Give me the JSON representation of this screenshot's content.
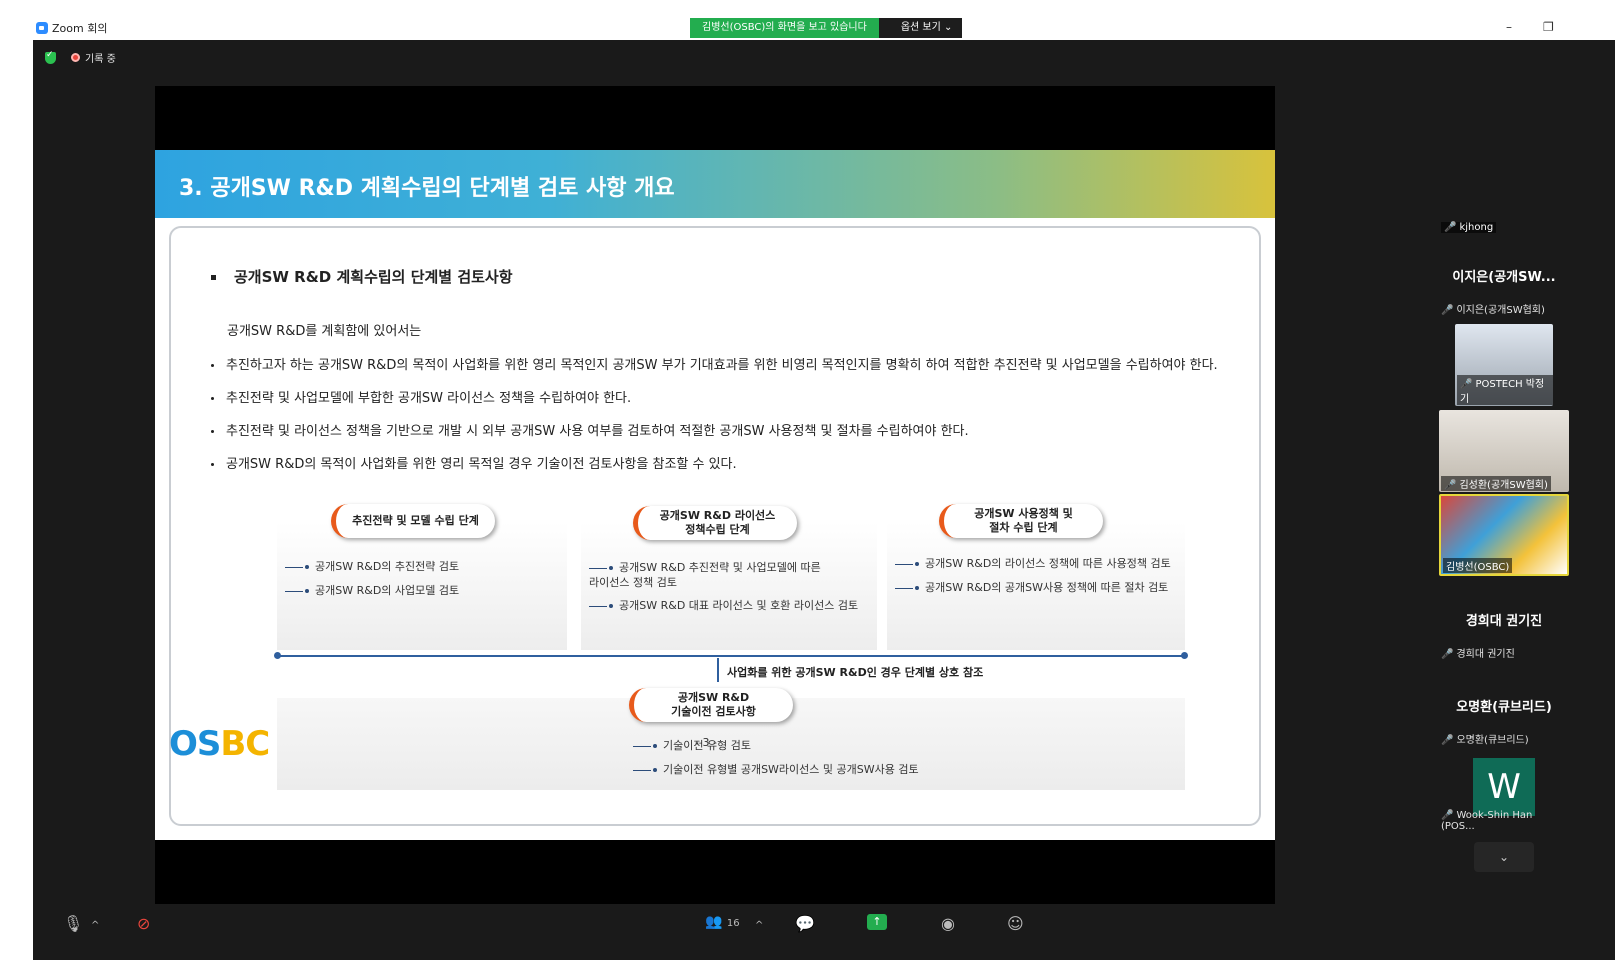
{
  "window": {
    "title": "Zoom 회의",
    "share_banner": "김병선(OSBC)의 화면을 보고 있습니다",
    "view_options": "옵션 보기 ⌄",
    "minimize": "–",
    "restore": "❐"
  },
  "status": {
    "recording": "기록 중"
  },
  "slide": {
    "title": "3. 공개SW R&D 계획수립의 단계별 검토 사항 개요",
    "heading": "공개SW R&D 계획수립의 단계별 검토사항",
    "intro": "공개SW R&D를 계획함에 있어서는",
    "bullets": [
      "추진하고자 하는 공개SW R&D의 목적이 사업화를 위한 영리 목적인지 공개SW 부가 기대효과를 위한 비영리 목적인지를 명확히 하여 적합한 추진전략 및 사업모델을 수립하여야 한다.",
      "추진전략 및 사업모델에 부합한 공개SW 라이선스 정책을 수립하여야 한다.",
      "추진전략 및 라이선스 정책을 기반으로 개발 시 외부 공개SW 사용 여부를 검토하여 적절한 공개SW 사용정책 및 절차를 수립하여야 한다.",
      "공개SW R&D의 목적이 사업화를 위한 영리 목적일 경우 기술이전 검토사항을 참조할 수 있다."
    ],
    "stages": [
      {
        "title": "추진전략 및 모델 수립 단계",
        "items": [
          "공개SW R&D의 추진전략 검토",
          "공개SW R&D의 사업모델 검토"
        ]
      },
      {
        "title": "공개SW R&D 라이선스\n정책수립 단계",
        "items": [
          "공개SW R&D 추진전략 및 사업모델에 따른\n라이선스 정책 검토",
          "공개SW R&D 대표 라이선스 및 호환 라이선스 검토"
        ]
      },
      {
        "title": "공개SW 사용정책 및\n절차 수립 단계",
        "items": [
          "공개SW R&D의 라이선스 정책에 따른 사용정책 검토",
          "공개SW R&D의 공개SW사용 정책에 따른 절차 검토"
        ]
      }
    ],
    "cross_ref": "사업화를 위한 공개SW R&D인 경우 단계별 상호 참조",
    "tech_transfer": {
      "title": "공개SW R&D\n기술이전 검토사항",
      "items": [
        "기술이전 유형 검토",
        "기술이전 유형별 공개SW라이선스 및 공개SW사용 검토"
      ]
    },
    "logo": "OSBC",
    "page": "- 3 -"
  },
  "participants": [
    {
      "name": "kjhong",
      "type": "video"
    },
    {
      "display": "이지은(공개SW...",
      "name": "이지은(공개SW협회)",
      "type": "name"
    },
    {
      "name": "POSTECH 박정기",
      "type": "video"
    },
    {
      "name": "김성환(공개SW협회)",
      "type": "video"
    },
    {
      "name": "김병선(OSBC)",
      "type": "video"
    },
    {
      "display": "경희대 권기진",
      "name": "경희대 권기진",
      "type": "name"
    },
    {
      "display": "오명환(큐브리드)",
      "name": "오명환(큐브리드)",
      "type": "name"
    },
    {
      "display": "W",
      "name": "Wook-Shin Han (POS...",
      "type": "avatar"
    }
  ],
  "toolbar": {
    "participants_count": "16"
  }
}
